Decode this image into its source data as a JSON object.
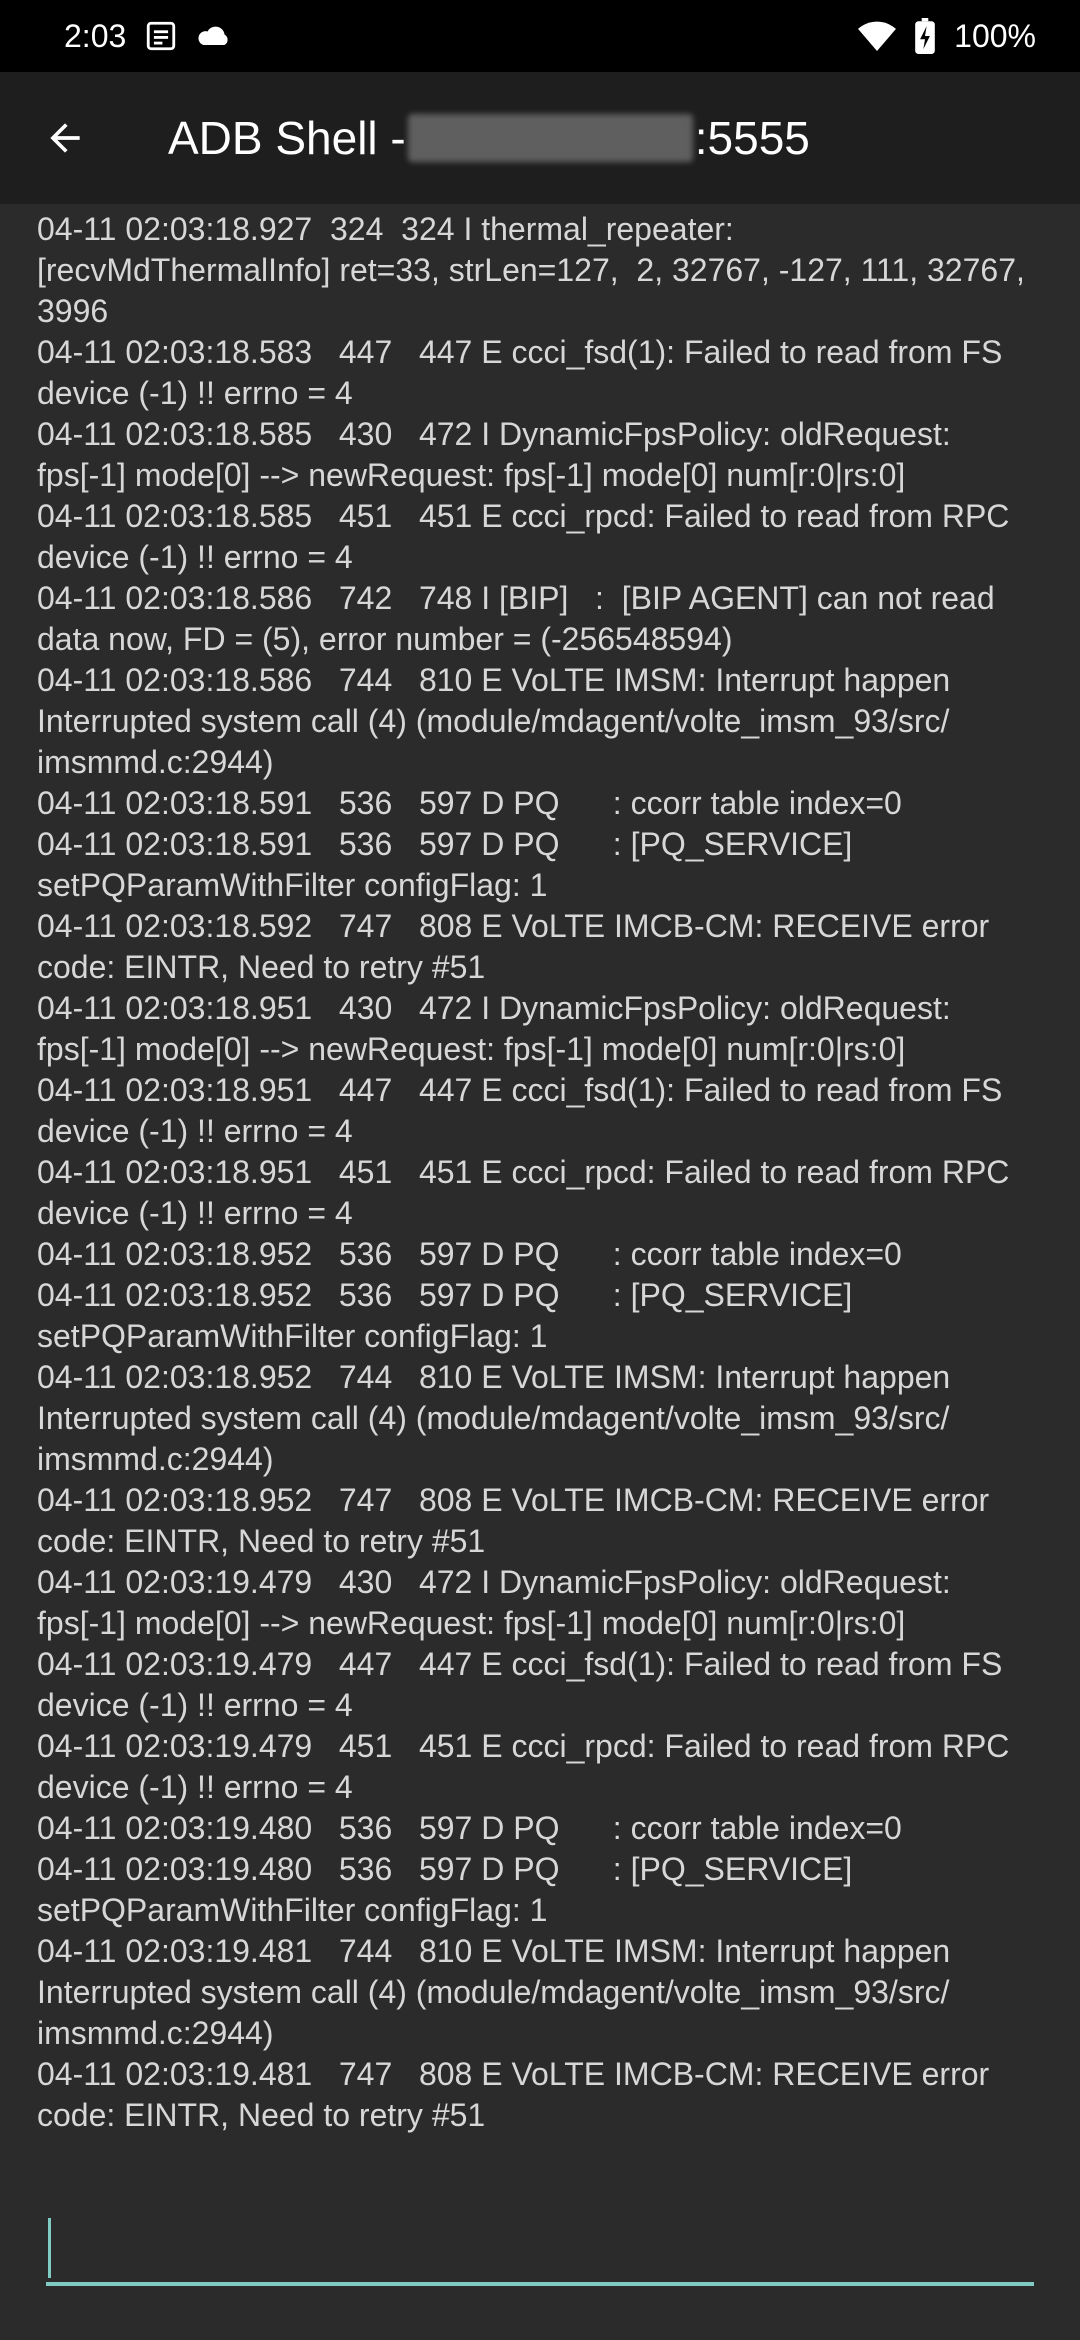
{
  "status_bar": {
    "time": "2:03",
    "icons_left": [
      "message-icon",
      "cloud-icon"
    ],
    "icons_right": [
      "wifi-icon",
      "battery-charging-icon"
    ],
    "battery": "100%"
  },
  "app_bar": {
    "back_icon": "arrow-back-icon",
    "title_prefix": "ADB Shell - ",
    "title_suffix": ":5555"
  },
  "log": {
    "text": "04-11 02:03:18.927  324  324 I thermal_repeater:\n[recvMdThermalInfo] ret=33, strLen=127,  2, 32767, -127, 111, 32767, 3996\n04-11 02:03:18.583   447   447 E ccci_fsd(1): Failed to read from FS device (-1) !! errno = 4\n04-11 02:03:18.585   430   472 I DynamicFpsPolicy: oldRequest: fps[-1] mode[0] --> newRequest: fps[-1] mode[0] num[r:0|rs:0]\n04-11 02:03:18.585   451   451 E ccci_rpcd: Failed to read from RPC device (-1) !! errno = 4\n04-11 02:03:18.586   742   748 I [BIP]   :  [BIP AGENT] can not read data now, FD = (5), error number = (-256548594)\n04-11 02:03:18.586   744   810 E VoLTE IMSM: Interrupt happen Interrupted system call (4) (module/mdagent/volte_imsm_93/src/ imsmmd.c:2944)\n04-11 02:03:18.591   536   597 D PQ      : ccorr table index=0\n04-11 02:03:18.591   536   597 D PQ      : [PQ_SERVICE] setPQParamWithFilter configFlag: 1\n04-11 02:03:18.592   747   808 E VoLTE IMCB-CM: RECEIVE error code: EINTR, Need to retry #51\n04-11 02:03:18.951   430   472 I DynamicFpsPolicy: oldRequest: fps[-1] mode[0] --> newRequest: fps[-1] mode[0] num[r:0|rs:0]\n04-11 02:03:18.951   447   447 E ccci_fsd(1): Failed to read from FS device (-1) !! errno = 4\n04-11 02:03:18.951   451   451 E ccci_rpcd: Failed to read from RPC device (-1) !! errno = 4\n04-11 02:03:18.952   536   597 D PQ      : ccorr table index=0\n04-11 02:03:18.952   536   597 D PQ      : [PQ_SERVICE] setPQParamWithFilter configFlag: 1\n04-11 02:03:18.952   744   810 E VoLTE IMSM: Interrupt happen Interrupted system call (4) (module/mdagent/volte_imsm_93/src/ imsmmd.c:2944)\n04-11 02:03:18.952   747   808 E VoLTE IMCB-CM: RECEIVE error code: EINTR, Need to retry #51\n04-11 02:03:19.479   430   472 I DynamicFpsPolicy: oldRequest: fps[-1] mode[0] --> newRequest: fps[-1] mode[0] num[r:0|rs:0]\n04-11 02:03:19.479   447   447 E ccci_fsd(1): Failed to read from FS device (-1) !! errno = 4\n04-11 02:03:19.479   451   451 E ccci_rpcd: Failed to read from RPC device (-1) !! errno = 4\n04-11 02:03:19.480   536   597 D PQ      : ccorr table index=0\n04-11 02:03:19.480   536   597 D PQ      : [PQ_SERVICE] setPQParamWithFilter configFlag: 1\n04-11 02:03:19.481   744   810 E VoLTE IMSM: Interrupt happen Interrupted system call (4) (module/mdagent/volte_imsm_93/src/ imsmmd.c:2944)\n04-11 02:03:19.481   747   808 E VoLTE IMCB-CM: RECEIVE error code: EINTR, Need to retry #51"
  },
  "input": {
    "value": "",
    "accent_color": "#80cbc4"
  },
  "colors": {
    "background": "#2b2b2b",
    "app_bar": "#1e1e1e",
    "status_bar": "#000000",
    "log_text": "#d7d7d7"
  }
}
